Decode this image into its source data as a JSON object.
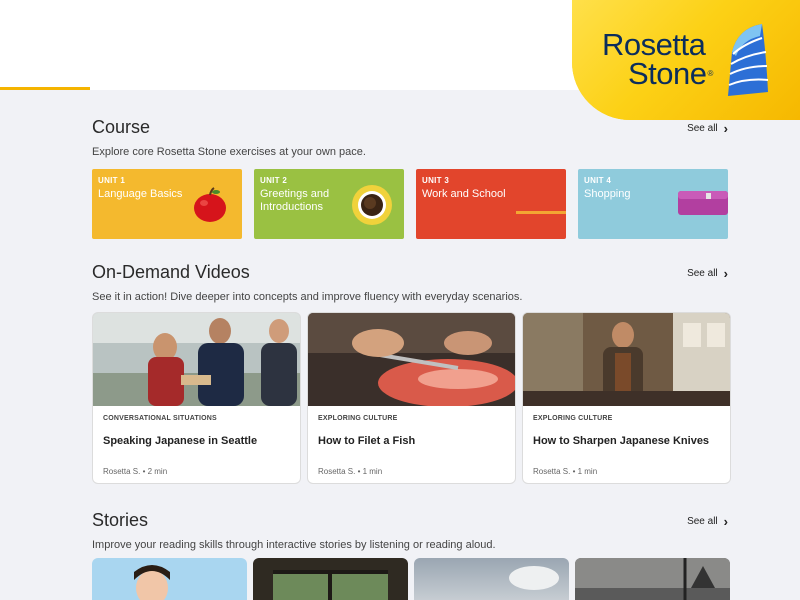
{
  "brand": {
    "name_line1": "Rosetta",
    "name_line2": "Stone",
    "trademark": "®"
  },
  "course": {
    "title": "Course",
    "description": "Explore core Rosetta Stone exercises at your own pace.",
    "see_all": "See all",
    "units": [
      {
        "number": "UNIT 1",
        "name": "Language Basics",
        "color": "#f4b92e",
        "icon": "apple-icon"
      },
      {
        "number": "UNIT 2",
        "name": "Greetings and Introductions",
        "color": "#9ac142",
        "icon": "coffee-cup-icon"
      },
      {
        "number": "UNIT 3",
        "name": "Work and School",
        "color": "#e2452c",
        "icon": "stripe-icon"
      },
      {
        "number": "UNIT 4",
        "name": "Shopping",
        "color": "#8fcbdc",
        "icon": "wallet-icon"
      }
    ]
  },
  "videos": {
    "title": "On-Demand Videos",
    "description": "See it in action! Dive deeper into concepts and improve fluency with everyday scenarios.",
    "see_all": "See all",
    "items": [
      {
        "category": "CONVERSATIONAL SITUATIONS",
        "title": "Speaking Japanese in Seattle",
        "meta": "Rosetta S. • 2 min"
      },
      {
        "category": "EXPLORING CULTURE",
        "title": "How to Filet a Fish",
        "meta": "Rosetta S. • 1 min"
      },
      {
        "category": "EXPLORING CULTURE",
        "title": "How to Sharpen Japanese Knives",
        "meta": "Rosetta S. • 1 min"
      }
    ]
  },
  "stories": {
    "title": "Stories",
    "description": "Improve your reading skills through interactive stories by listening or reading aloud.",
    "see_all": "See all"
  }
}
